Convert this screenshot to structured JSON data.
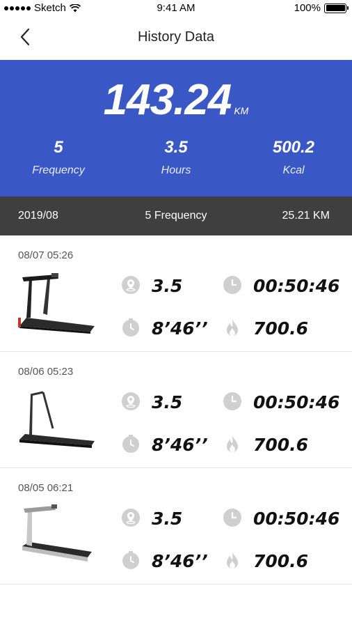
{
  "status_bar": {
    "carrier": "Sketch",
    "time": "9:41 AM",
    "battery": "100%"
  },
  "nav": {
    "title": "History Data"
  },
  "summary": {
    "total_distance": "143.24",
    "total_unit": "KM",
    "stats": [
      {
        "value": "5",
        "label": "Frequency"
      },
      {
        "value": "3.5",
        "label": "Hours"
      },
      {
        "value": "500.2",
        "label": "Kcal"
      }
    ]
  },
  "month_bar": {
    "month": "2019/08",
    "frequency": "5 Frequency",
    "distance": "25.21 KM"
  },
  "records": [
    {
      "datetime": "08/07 05:26",
      "distance": "3.5",
      "duration": "00:50:46",
      "pace": "8’46’’",
      "calories": "700.6"
    },
    {
      "datetime": "08/06 05:23",
      "distance": "3.5",
      "duration": "00:50:46",
      "pace": "8’46’’",
      "calories": "700.6"
    },
    {
      "datetime": "08/05 06:21",
      "distance": "3.5",
      "duration": "00:50:46",
      "pace": "8’46’’",
      "calories": "700.6"
    }
  ],
  "colors": {
    "accent": "#3a57c6",
    "month_bar": "#3f3f3f",
    "icon_gray": "#cfcfcf"
  }
}
